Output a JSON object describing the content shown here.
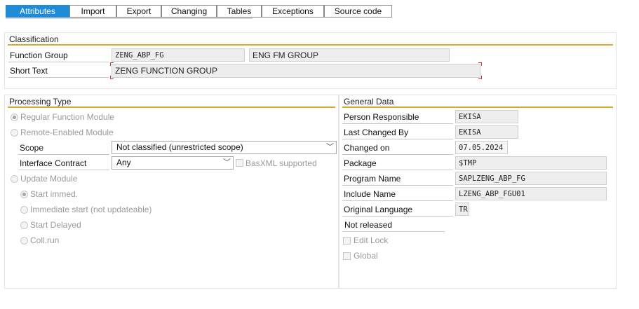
{
  "tabs": [
    "Attributes",
    "Import",
    "Export",
    "Changing",
    "Tables",
    "Exceptions",
    "Source code"
  ],
  "classification": {
    "title": "Classification",
    "function_group_label": "Function Group",
    "function_group_value": "ZENG_ABP_FG",
    "function_group_desc": "ENG FM GROUP",
    "short_text_label": "Short Text",
    "short_text_value": "ZENG FUNCTION GROUP"
  },
  "processing": {
    "title": "Processing Type",
    "regular": "Regular Function Module",
    "remote": "Remote-Enabled Module",
    "scope_label": "Scope",
    "scope_value": "Not classified (unrestricted scope)",
    "interface_label": "Interface Contract",
    "interface_value": "Any",
    "basxml": "BasXML supported",
    "update": "Update Module",
    "start_immed": "Start immed.",
    "immediate_start": "Immediate start (not updateable)",
    "start_delayed": "Start Delayed",
    "coll_run": "Coll.run"
  },
  "general": {
    "title": "General Data",
    "person_label": "Person Responsible",
    "person_value": "EKISA",
    "last_changed_label": "Last Changed By",
    "last_changed_value": "EKISA",
    "changed_on_label": "Changed on",
    "changed_on_value": "07.05.2024",
    "package_label": "Package",
    "package_value": "$TMP",
    "program_label": "Program Name",
    "program_value": "SAPLZENG_ABP_FG",
    "include_label": "Include Name",
    "include_value": "LZENG_ABP_FGU01",
    "language_label": "Original Language",
    "language_value": "TR",
    "status": "Not released",
    "edit_lock": "Edit Lock",
    "global": "Global"
  }
}
